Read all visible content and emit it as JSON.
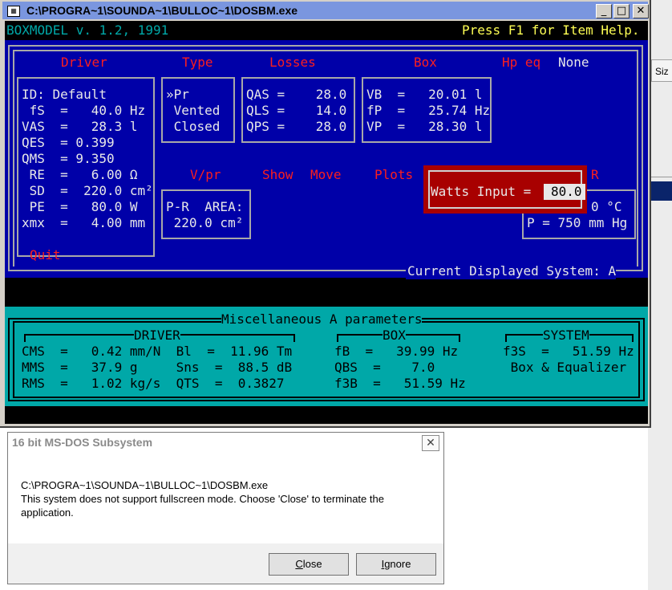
{
  "window": {
    "title": "C:\\PROGRA~1\\SOUNDA~1\\BULLOC~1\\DOSBM.exe",
    "min_glyph": "_",
    "max_glyph": "□",
    "close_glyph": "✕"
  },
  "background": {
    "button_fragment": "Siz"
  },
  "dos": {
    "header_left": "BOXMODEL v. 1.2, 1991",
    "header_right": "Press F1 for Item Help.",
    "menu": {
      "driver": "Driver",
      "type": "Type",
      "losses": "Losses",
      "box": "Box",
      "hp_eq": "Hp eq",
      "hp_eq_value": "None",
      "vpr": "V/pr",
      "show": "Show",
      "move": "Move",
      "plots": "Plots",
      "r_fragment": "R",
      "quit": "Quit"
    },
    "driver_lines": [
      "ID: Default",
      " fS  =   40.0 Hz",
      "VAS  =   28.3 l",
      "QES  = 0.399",
      "QMS  = 9.350",
      " RE  =   6.00 Ω",
      " SD  =  220.0 cm²",
      " PE  =   80.0 W",
      "xmx  =   4.00 mm"
    ],
    "type_lines": [
      "»Pr",
      " Vented",
      " Closed"
    ],
    "losses_lines": [
      "QAS =    28.0",
      "QLS =    14.0",
      "QPS =    28.0"
    ],
    "box_lines": [
      "VB  =   20.01 l",
      "fP  =   25.74 Hz",
      "VP  =   28.30 l"
    ],
    "vpr_lines": [
      "P-R  AREA:",
      " 220.0 cm²"
    ],
    "env_lines": [
      "0 °C",
      "P = 750 mm Hg"
    ],
    "watts": {
      "label": "Watts Input = ",
      "value": "80.0"
    },
    "current_system": "Current Displayed System: A",
    "misc_title": "Miscellaneous A parameters",
    "driver_header": "DRIVER",
    "box_header": "BOX",
    "system_header": "SYSTEM",
    "misc_driver_lines": [
      "CMS  =   0.42 mm/N  Bl  =  11.96 Tm",
      "MMS  =   37.9 g     Sns  =  88.5 dB",
      "RMS  =   1.02 kg/s  QTS  =  0.3827"
    ],
    "misc_box_lines": [
      "fB  =   39.99 Hz",
      "QBS  =    7.0",
      "f3B  =   51.59 Hz"
    ],
    "misc_system_lines": [
      "f3S  =   51.59 Hz",
      " Box & Equalizer"
    ]
  },
  "dialog": {
    "title": "16 bit MS-DOS Subsystem",
    "close_glyph": "✕",
    "path": "C:\\PROGRA~1\\SOUNDA~1\\BULLOC~1\\DOSBM.exe",
    "message_line1": "This system does not support fullscreen mode. Choose 'Close' to terminate the",
    "message_line2": "application.",
    "close_button_first": "C",
    "close_button_rest": "lose",
    "ignore_button_first": "I",
    "ignore_button_rest": "gnore"
  }
}
